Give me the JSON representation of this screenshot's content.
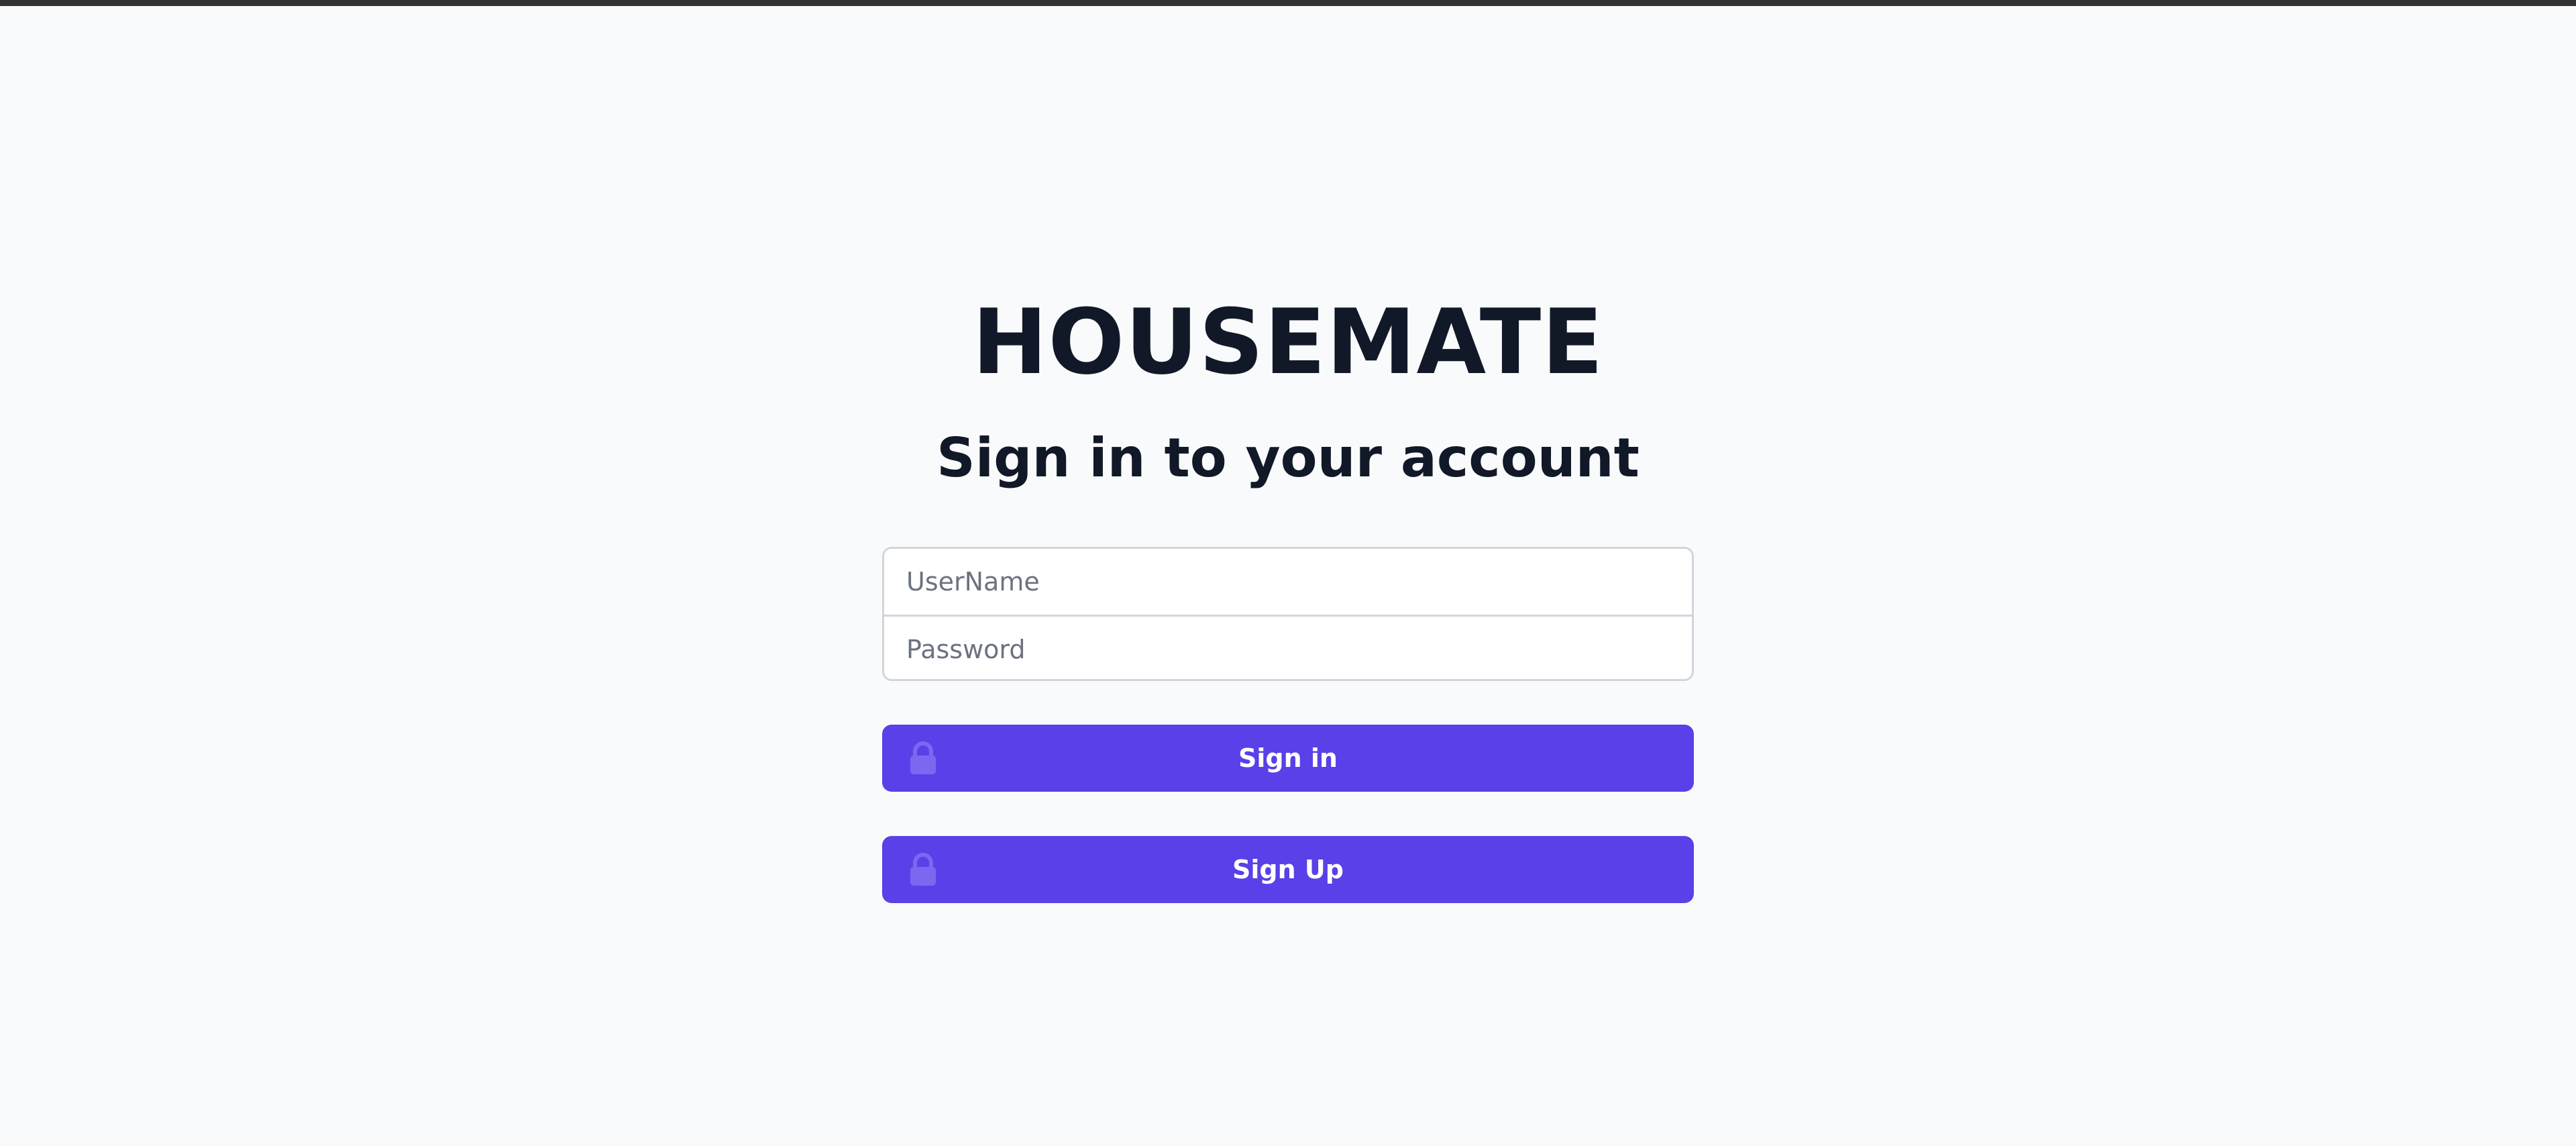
{
  "app": {
    "brand": "HOUSEMATE",
    "heading": "Sign in to your account"
  },
  "form": {
    "username_placeholder": "UserName",
    "username_value": "",
    "password_placeholder": "Password",
    "password_value": ""
  },
  "buttons": {
    "sign_in_label": "Sign in",
    "sign_up_label": "Sign Up"
  },
  "icons": {
    "button_icon": "lock-icon"
  },
  "colors": {
    "background": "#f9fafb",
    "text": "#111827",
    "accent": "#5841e8",
    "lock_icon": "#7a68f0",
    "input_border": "#d1d5db",
    "placeholder": "#6b7280"
  }
}
